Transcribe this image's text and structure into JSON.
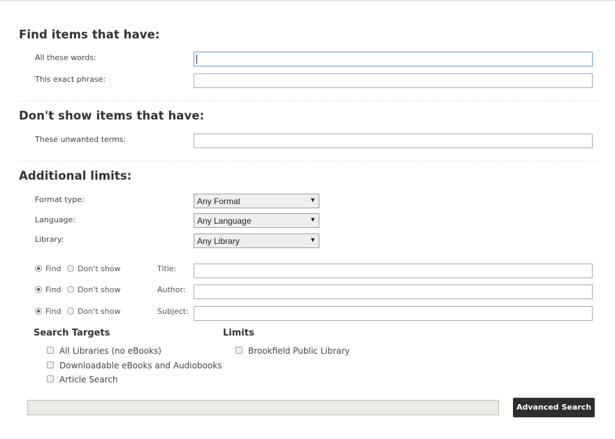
{
  "find_section": {
    "heading": "Find items that have:",
    "all_words_label": "All these words:",
    "all_words_value": "",
    "exact_phrase_label": "This exact phrase:",
    "exact_phrase_value": ""
  },
  "dont_show_section": {
    "heading": "Don't show items that have:",
    "unwanted_label": "These unwanted terms:",
    "unwanted_value": ""
  },
  "limits_section": {
    "heading": "Additional limits:",
    "format_label": "Format type:",
    "format_value": "Any Format",
    "language_label": "Language:",
    "language_value": "Any Language",
    "library_label": "Library:",
    "library_value": "Any Library",
    "field_rows": [
      {
        "find_label": "Find",
        "dont_label": "Don't show",
        "field_label": "Title:",
        "value": ""
      },
      {
        "find_label": "Find",
        "dont_label": "Don't show",
        "field_label": "Author:",
        "value": ""
      },
      {
        "find_label": "Find",
        "dont_label": "Don't show",
        "field_label": "Subject:",
        "value": ""
      }
    ]
  },
  "search_targets": {
    "heading": "Search Targets",
    "items": [
      "All Libraries (no eBooks)",
      "Downloadable eBooks and Audiobooks",
      "Article Search"
    ]
  },
  "limits": {
    "heading": "Limits",
    "items": [
      "Brookfield Public Library"
    ]
  },
  "footer": {
    "search_button": "Advanced Search"
  }
}
